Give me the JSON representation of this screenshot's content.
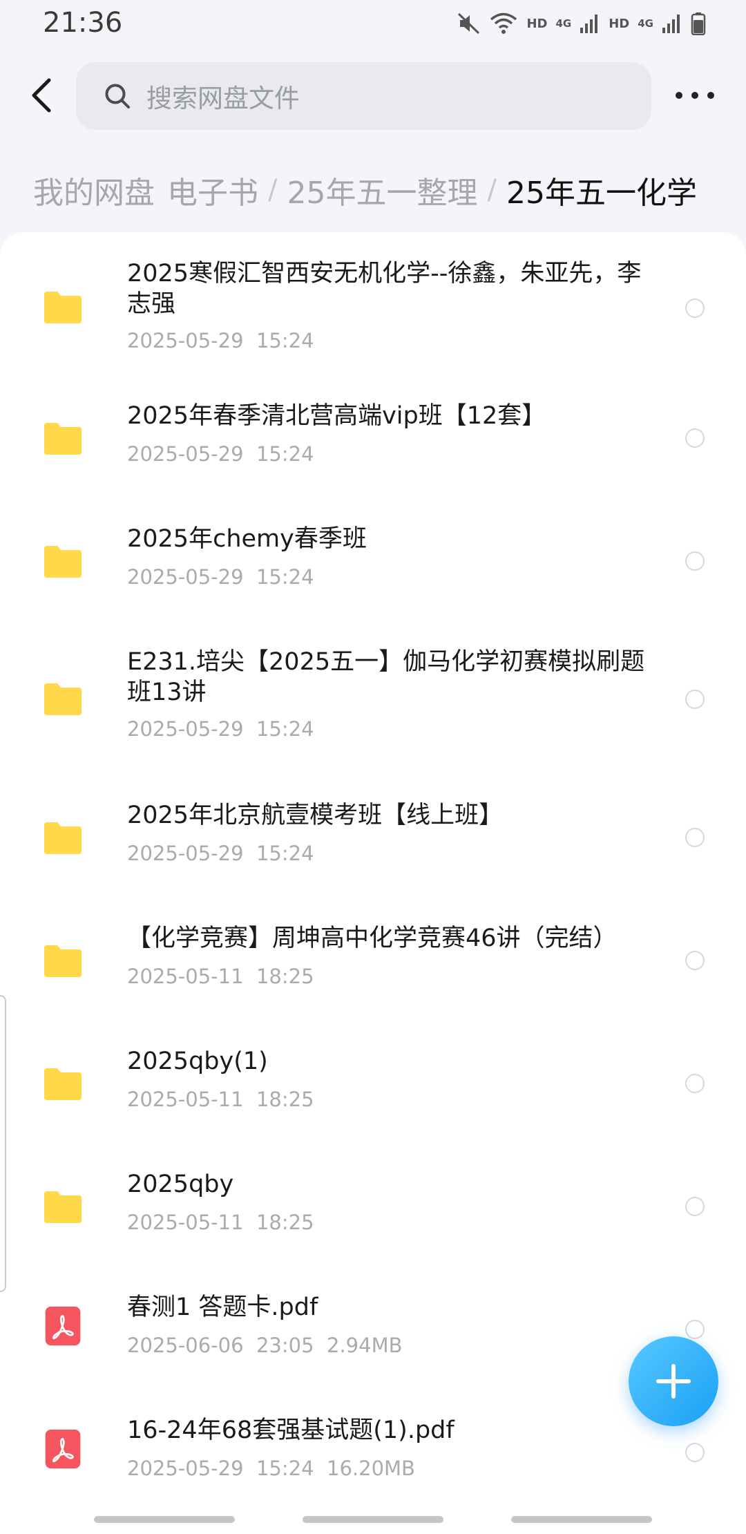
{
  "status_bar": {
    "time": "21:36",
    "icons": [
      "mute-icon",
      "wifi-icon",
      "signal-icon",
      "signal-icon",
      "battery-icon"
    ],
    "hd_1": "HD",
    "net_1": "4G",
    "hd_2": "HD",
    "net_2": "4G"
  },
  "header": {
    "back_icon": "chevron-left-icon",
    "search_placeholder": "搜索网盘文件",
    "more_icon": "more-dots-icon"
  },
  "breadcrumb": {
    "items": [
      "我的网盘",
      "电子书",
      "25年五一整理",
      "25年五一化学"
    ],
    "separator": "/"
  },
  "files": [
    {
      "type": "folder",
      "name": "2025寒假汇智西安无机化学--徐鑫，朱亚先，李志强",
      "date": "2025-05-29",
      "time": "15:24",
      "size": ""
    },
    {
      "type": "folder",
      "name": "2025年春季清北营高端vip班【12套】",
      "date": "2025-05-29",
      "time": "15:24",
      "size": ""
    },
    {
      "type": "folder",
      "name": "2025年chemy春季班",
      "date": "2025-05-29",
      "time": "15:24",
      "size": ""
    },
    {
      "type": "folder",
      "name": "E231.培尖【2025五一】伽马化学初赛模拟刷题班13讲",
      "date": "2025-05-29",
      "time": "15:24",
      "size": ""
    },
    {
      "type": "folder",
      "name": "2025年北京航壹模考班【线上班】",
      "date": "2025-05-29",
      "time": "15:24",
      "size": ""
    },
    {
      "type": "folder",
      "name": "【化学竞赛】周坤高中化学竞赛46讲（完结）",
      "date": "2025-05-11",
      "time": "18:25",
      "size": ""
    },
    {
      "type": "folder",
      "name": "2025qby(1)",
      "date": "2025-05-11",
      "time": "18:25",
      "size": ""
    },
    {
      "type": "folder",
      "name": "2025qby",
      "date": "2025-05-11",
      "time": "18:25",
      "size": ""
    },
    {
      "type": "pdf",
      "name": "春测1 答题卡.pdf",
      "date": "2025-06-06",
      "time": "23:05",
      "size": "2.94MB"
    },
    {
      "type": "pdf",
      "name": "16-24年68套强基试题(1).pdf",
      "date": "2025-05-29",
      "time": "15:24",
      "size": "16.20MB"
    }
  ],
  "fab_icon": "plus-icon",
  "colors": {
    "folder": "#FFD94A",
    "pdf": "#F5555F",
    "fab": "#1AA0F5",
    "background": "#F4F5F8"
  }
}
